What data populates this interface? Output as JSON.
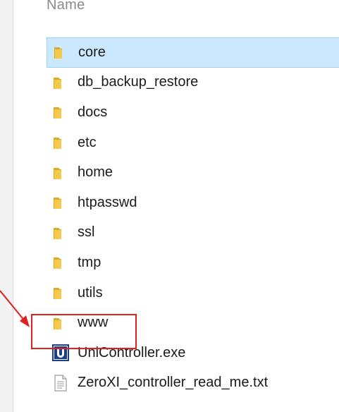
{
  "header": {
    "name_column": "Name"
  },
  "files": [
    {
      "label": "core",
      "type": "folder",
      "selected": true
    },
    {
      "label": "db_backup_restore",
      "type": "folder",
      "selected": false
    },
    {
      "label": "docs",
      "type": "folder",
      "selected": false
    },
    {
      "label": "etc",
      "type": "folder",
      "selected": false
    },
    {
      "label": "home",
      "type": "folder",
      "selected": false
    },
    {
      "label": "htpasswd",
      "type": "folder",
      "selected": false
    },
    {
      "label": "ssl",
      "type": "folder",
      "selected": false
    },
    {
      "label": "tmp",
      "type": "folder",
      "selected": false
    },
    {
      "label": "utils",
      "type": "folder",
      "selected": false
    },
    {
      "label": "www",
      "type": "folder",
      "selected": false,
      "highlighted": true
    },
    {
      "label": "UniController.exe",
      "type": "exe",
      "selected": false
    },
    {
      "label": "ZeroXI_controller_read_me.txt",
      "type": "txt",
      "selected": false
    }
  ],
  "icons": {
    "folder": "folder-icon",
    "exe": "unicontroller-app-icon",
    "txt": "text-document-icon"
  },
  "colors": {
    "selection_bg": "#cce8ff",
    "selection_border": "#99d1ff",
    "folder_fill": "#f5c94a",
    "folder_dark": "#dcaa2a",
    "highlight": "#e0201b",
    "exe_blue": "#1c3d8c"
  }
}
